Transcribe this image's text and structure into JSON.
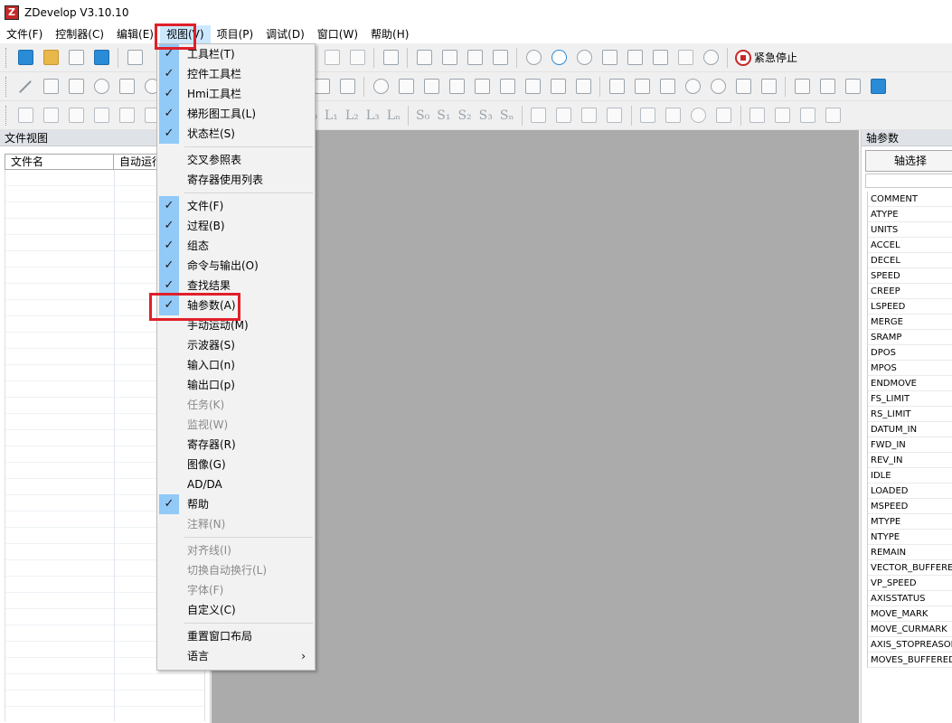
{
  "window": {
    "title": "ZDevelop V3.10.10"
  },
  "menubar": [
    "文件(F)",
    "控制器(C)",
    "编辑(E)",
    "视图(V)",
    "项目(P)",
    "调试(D)",
    "窗口(W)",
    "帮助(H)"
  ],
  "toolbar": {
    "emergency_stop_label": "紧急停止",
    "ladder_labels": [
      "L₀",
      "L₁",
      "L₂",
      "L₃",
      "Lₙ",
      "S₀",
      "S₁",
      "S₂",
      "S₃",
      "Sₙ"
    ]
  },
  "left_panel": {
    "title": "文件视图",
    "columns": [
      "文件名",
      "自动运行"
    ]
  },
  "right_panel": {
    "title": "轴参数",
    "axis_select_label": "轴选择",
    "params": [
      "COMMENT",
      "ATYPE",
      "UNITS",
      "ACCEL",
      "DECEL",
      "SPEED",
      "CREEP",
      "LSPEED",
      "MERGE",
      "SRAMP",
      "DPOS",
      "MPOS",
      "ENDMOVE",
      "FS_LIMIT",
      "RS_LIMIT",
      "DATUM_IN",
      "FWD_IN",
      "REV_IN",
      "IDLE",
      "LOADED",
      "MSPEED",
      "MTYPE",
      "NTYPE",
      "REMAIN",
      "VECTOR_BUFFERED",
      "VP_SPEED",
      "AXISSTATUS",
      "MOVE_MARK",
      "MOVE_CURMARK",
      "AXIS_STOPREASON",
      "MOVES_BUFFERED"
    ]
  },
  "view_menu": {
    "items": [
      {
        "label": "工具栏(T)",
        "checked": true
      },
      {
        "label": "控件工具栏",
        "checked": true
      },
      {
        "label": "Hmi工具栏",
        "checked": true
      },
      {
        "label": "梯形图工具(L)",
        "checked": true
      },
      {
        "label": "状态栏(S)",
        "checked": true
      },
      {
        "label": "交叉参照表"
      },
      {
        "label": "寄存器使用列表"
      },
      {
        "label": "文件(F)",
        "checked": true
      },
      {
        "label": "过程(B)",
        "checked": true
      },
      {
        "label": "组态",
        "checked": true
      },
      {
        "label": "命令与输出(O)",
        "checked": true
      },
      {
        "label": "查找结果",
        "checked": true
      },
      {
        "label": "轴参数(A)",
        "checked": true
      },
      {
        "label": "手动运动(M)"
      },
      {
        "label": "示波器(S)"
      },
      {
        "label": "输入口(n)"
      },
      {
        "label": "输出口(p)"
      },
      {
        "label": "任务(K)",
        "disabled": true
      },
      {
        "label": "监视(W)",
        "disabled": true
      },
      {
        "label": "寄存器(R)"
      },
      {
        "label": "图像(G)"
      },
      {
        "label": "AD/DA"
      },
      {
        "label": "帮助",
        "checked": true
      },
      {
        "label": "注释(N)",
        "disabled": true
      },
      {
        "label": "对齐线(I)",
        "disabled": true
      },
      {
        "label": "切换自动换行(L)",
        "disabled": true
      },
      {
        "label": "字体(F)",
        "disabled": true
      },
      {
        "label": "自定义(C)"
      },
      {
        "label": "重置窗口布局"
      },
      {
        "label": "语言",
        "submenu": true
      }
    ]
  },
  "colors": {
    "highlight_box": "#e0202a",
    "check_bg": "#91c9f7",
    "workspace": "#ababab"
  }
}
